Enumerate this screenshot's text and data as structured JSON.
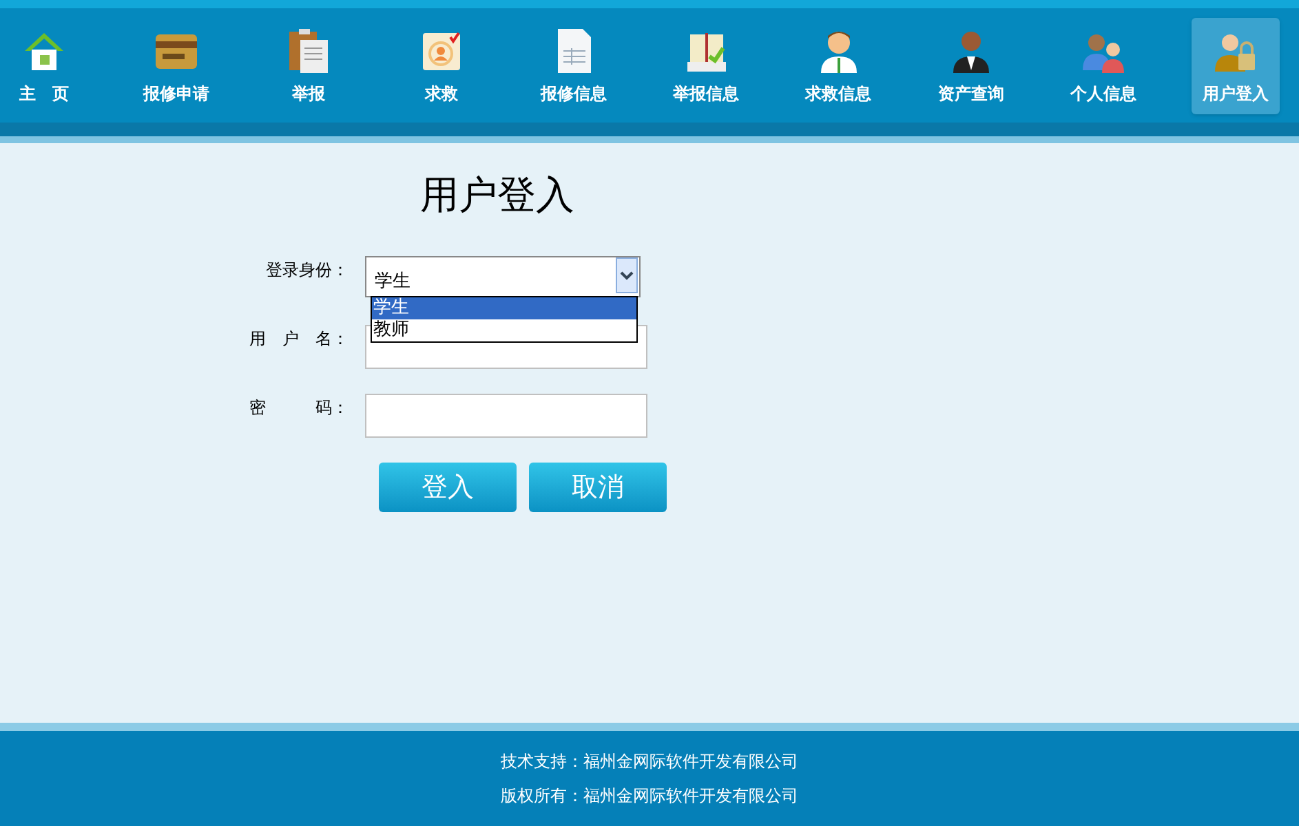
{
  "nav": [
    {
      "label": "主　页",
      "kind": "house",
      "selected": false
    },
    {
      "label": "报修申请",
      "kind": "card",
      "selected": false
    },
    {
      "label": "举报",
      "kind": "clipboard",
      "selected": false
    },
    {
      "label": "求救",
      "kind": "badge",
      "selected": false
    },
    {
      "label": "报修信息",
      "kind": "document",
      "selected": false
    },
    {
      "label": "举报信息",
      "kind": "book",
      "selected": false
    },
    {
      "label": "求救信息",
      "kind": "person",
      "selected": false
    },
    {
      "label": "资产查询",
      "kind": "waiter",
      "selected": false
    },
    {
      "label": "个人信息",
      "kind": "people",
      "selected": false
    },
    {
      "label": "用户登入",
      "kind": "lock",
      "selected": true
    }
  ],
  "title": "用户登入",
  "form": {
    "role_label": "登录身份：",
    "role_value": "学生",
    "role_options": [
      {
        "label": "学生",
        "selected": true
      },
      {
        "label": "教师",
        "selected": false
      }
    ],
    "username_label": "用　户　名：",
    "password_label": "密　　　码：",
    "buttons": [
      "登入",
      "取消"
    ]
  },
  "footer": [
    "技术支持：福州金网际软件开发有限公司",
    "版权所有：福州金网际软件开发有限公司"
  ]
}
